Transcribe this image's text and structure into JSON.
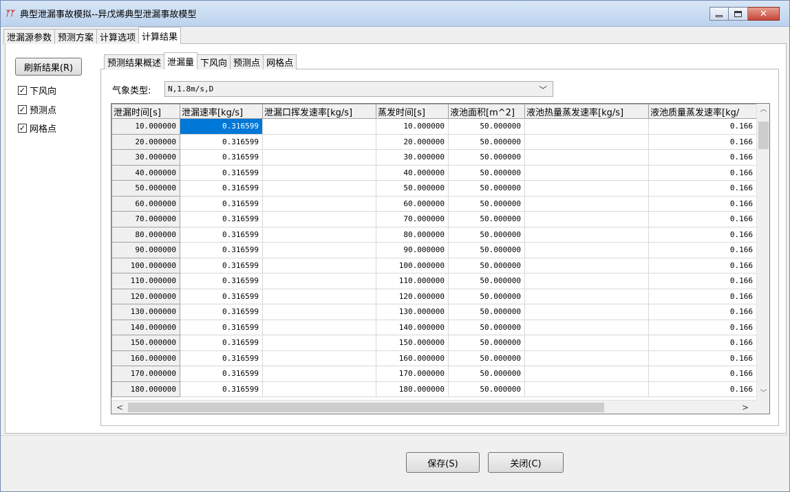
{
  "window": {
    "title": "典型泄漏事故模拟--异戊烯典型泄漏事故模型",
    "icon_name": "app-logo-icon",
    "controls": [
      "minimize",
      "maximize",
      "close"
    ]
  },
  "outer_tabs": [
    {
      "label": "泄漏源参数",
      "active": false
    },
    {
      "label": "预测方案",
      "active": false
    },
    {
      "label": "计算选项",
      "active": false
    },
    {
      "label": "计算结果",
      "active": true
    }
  ],
  "left_panel": {
    "refresh_label": "刷新结果(R)",
    "checkboxes": [
      {
        "label": "下风向",
        "checked": true
      },
      {
        "label": "预测点",
        "checked": true
      },
      {
        "label": "网格点",
        "checked": true
      }
    ]
  },
  "inner_tabs": [
    {
      "label": "预测结果概述",
      "active": false
    },
    {
      "label": "泄漏量",
      "active": true
    },
    {
      "label": "下风向",
      "active": false
    },
    {
      "label": "预测点",
      "active": false
    },
    {
      "label": "网格点",
      "active": false
    }
  ],
  "weather": {
    "label": "气象类型:",
    "value": "N,1.8m/s,D"
  },
  "table": {
    "columns": [
      "泄漏时间[s]",
      "泄漏速率[kg/s]",
      "泄漏口挥发速率[kg/s]",
      "蒸发时间[s]",
      "液池面积[m^2]",
      "液池热量蒸发速率[kg/s]",
      "液池质量蒸发速率[kg/"
    ],
    "rows": [
      [
        "10.000000",
        "0.316599",
        "",
        "10.000000",
        "50.000000",
        "",
        "0.166"
      ],
      [
        "20.000000",
        "0.316599",
        "",
        "20.000000",
        "50.000000",
        "",
        "0.166"
      ],
      [
        "30.000000",
        "0.316599",
        "",
        "30.000000",
        "50.000000",
        "",
        "0.166"
      ],
      [
        "40.000000",
        "0.316599",
        "",
        "40.000000",
        "50.000000",
        "",
        "0.166"
      ],
      [
        "50.000000",
        "0.316599",
        "",
        "50.000000",
        "50.000000",
        "",
        "0.166"
      ],
      [
        "60.000000",
        "0.316599",
        "",
        "60.000000",
        "50.000000",
        "",
        "0.166"
      ],
      [
        "70.000000",
        "0.316599",
        "",
        "70.000000",
        "50.000000",
        "",
        "0.166"
      ],
      [
        "80.000000",
        "0.316599",
        "",
        "80.000000",
        "50.000000",
        "",
        "0.166"
      ],
      [
        "90.000000",
        "0.316599",
        "",
        "90.000000",
        "50.000000",
        "",
        "0.166"
      ],
      [
        "100.000000",
        "0.316599",
        "",
        "100.000000",
        "50.000000",
        "",
        "0.166"
      ],
      [
        "110.000000",
        "0.316599",
        "",
        "110.000000",
        "50.000000",
        "",
        "0.166"
      ],
      [
        "120.000000",
        "0.316599",
        "",
        "120.000000",
        "50.000000",
        "",
        "0.166"
      ],
      [
        "130.000000",
        "0.316599",
        "",
        "130.000000",
        "50.000000",
        "",
        "0.166"
      ],
      [
        "140.000000",
        "0.316599",
        "",
        "140.000000",
        "50.000000",
        "",
        "0.166"
      ],
      [
        "150.000000",
        "0.316599",
        "",
        "150.000000",
        "50.000000",
        "",
        "0.166"
      ],
      [
        "160.000000",
        "0.316599",
        "",
        "160.000000",
        "50.000000",
        "",
        "0.166"
      ],
      [
        "170.000000",
        "0.316599",
        "",
        "170.000000",
        "50.000000",
        "",
        "0.166"
      ],
      [
        "180.000000",
        "0.316599",
        "",
        "180.000000",
        "50.000000",
        "",
        "0.166"
      ]
    ],
    "selected_cell": {
      "row": 0,
      "col": 1
    }
  },
  "footer": {
    "save_label": "保存(S)",
    "close_label": "关闭(C)"
  },
  "colors": {
    "selection": "#0078d7",
    "titlebar": "#c6d9f0",
    "close_button": "#c7473a"
  }
}
